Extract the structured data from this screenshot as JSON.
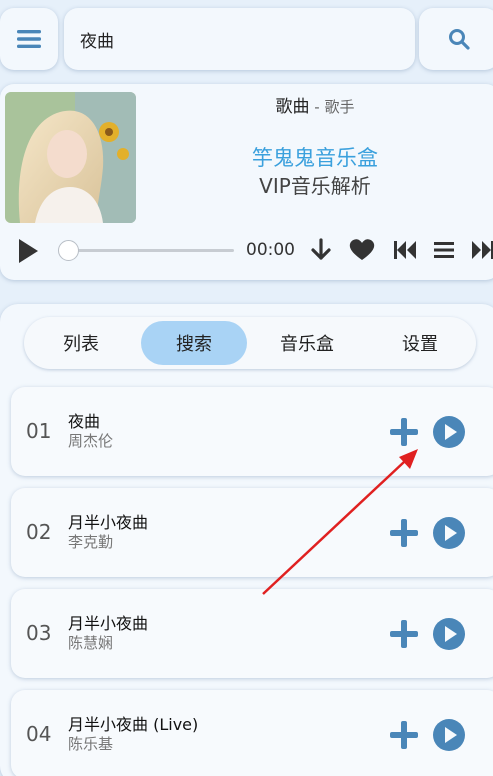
{
  "search": {
    "value": "夜曲"
  },
  "player": {
    "song_label": "歌曲",
    "separator": " - ",
    "artist_label": "歌手",
    "brand": "竽鬼鬼音乐盒",
    "brand_sub": "VIP音乐解析",
    "time": "00:00",
    "progress": 0
  },
  "tabs": [
    {
      "label": "列表",
      "active": false
    },
    {
      "label": "搜索",
      "active": true
    },
    {
      "label": "音乐盒",
      "active": false
    },
    {
      "label": "设置",
      "active": false
    }
  ],
  "songs": [
    {
      "num": "01",
      "title": "夜曲",
      "artist": "周杰伦"
    },
    {
      "num": "02",
      "title": "月半小夜曲",
      "artist": "李克勤"
    },
    {
      "num": "03",
      "title": "月半小夜曲",
      "artist": "陈慧娴"
    },
    {
      "num": "04",
      "title": "月半小夜曲 (Live)",
      "artist": "陈乐基"
    }
  ],
  "colors": {
    "accent": "#3aa0dd",
    "icon": "#4a86b8",
    "tab_active": "#a9d3f5",
    "annotation": "#e02020"
  },
  "icons": {
    "menu": "menu-icon",
    "search": "search-icon",
    "play": "play-icon",
    "download": "download-icon",
    "heart": "heart-icon",
    "previous": "previous-icon",
    "playlist": "playlist-icon",
    "next": "next-icon",
    "add": "add-icon"
  }
}
